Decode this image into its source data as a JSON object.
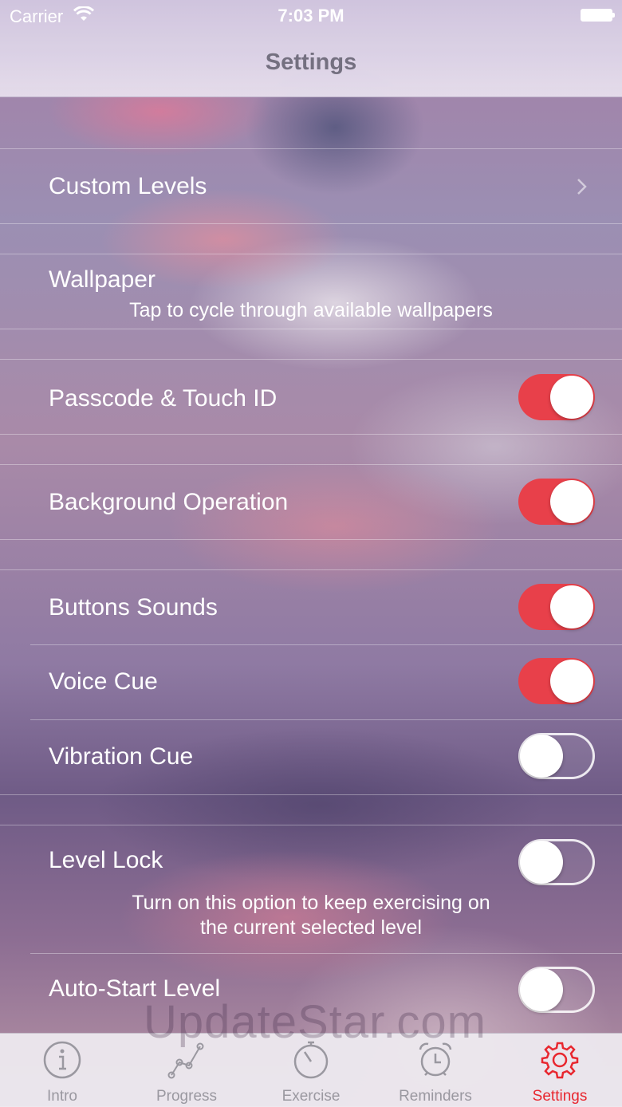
{
  "status_bar": {
    "carrier": "Carrier",
    "time": "7:03 PM"
  },
  "nav": {
    "title": "Settings"
  },
  "settings": {
    "custom_levels": {
      "label": "Custom Levels"
    },
    "wallpaper": {
      "label": "Wallpaper",
      "subtitle": "Tap to cycle through available wallpapers"
    },
    "passcode": {
      "label": "Passcode & Touch ID",
      "on": true
    },
    "background_operation": {
      "label": "Background Operation",
      "on": true
    },
    "buttons_sounds": {
      "label": "Buttons Sounds",
      "on": true
    },
    "voice_cue": {
      "label": "Voice Cue",
      "on": true
    },
    "vibration_cue": {
      "label": "Vibration Cue",
      "on": false
    },
    "level_lock": {
      "label": "Level Lock",
      "on": false,
      "subtitle_line1": "Turn on this option to keep exercising on",
      "subtitle_line2": "the current selected level"
    },
    "auto_start": {
      "label": "Auto-Start Level",
      "on": false
    }
  },
  "watermark": "UpdateStar.com",
  "tabs": [
    {
      "label": "Intro",
      "icon": "info-icon",
      "active": false
    },
    {
      "label": "Progress",
      "icon": "graph-icon",
      "active": false
    },
    {
      "label": "Exercise",
      "icon": "stopwatch-icon",
      "active": false
    },
    {
      "label": "Reminders",
      "icon": "alarm-clock-icon",
      "active": false
    },
    {
      "label": "Settings",
      "icon": "gear-icon",
      "active": true
    }
  ],
  "colors": {
    "accent": "#e8404a",
    "tab_active": "#e8272f",
    "tab_inactive": "#9a98a0"
  }
}
